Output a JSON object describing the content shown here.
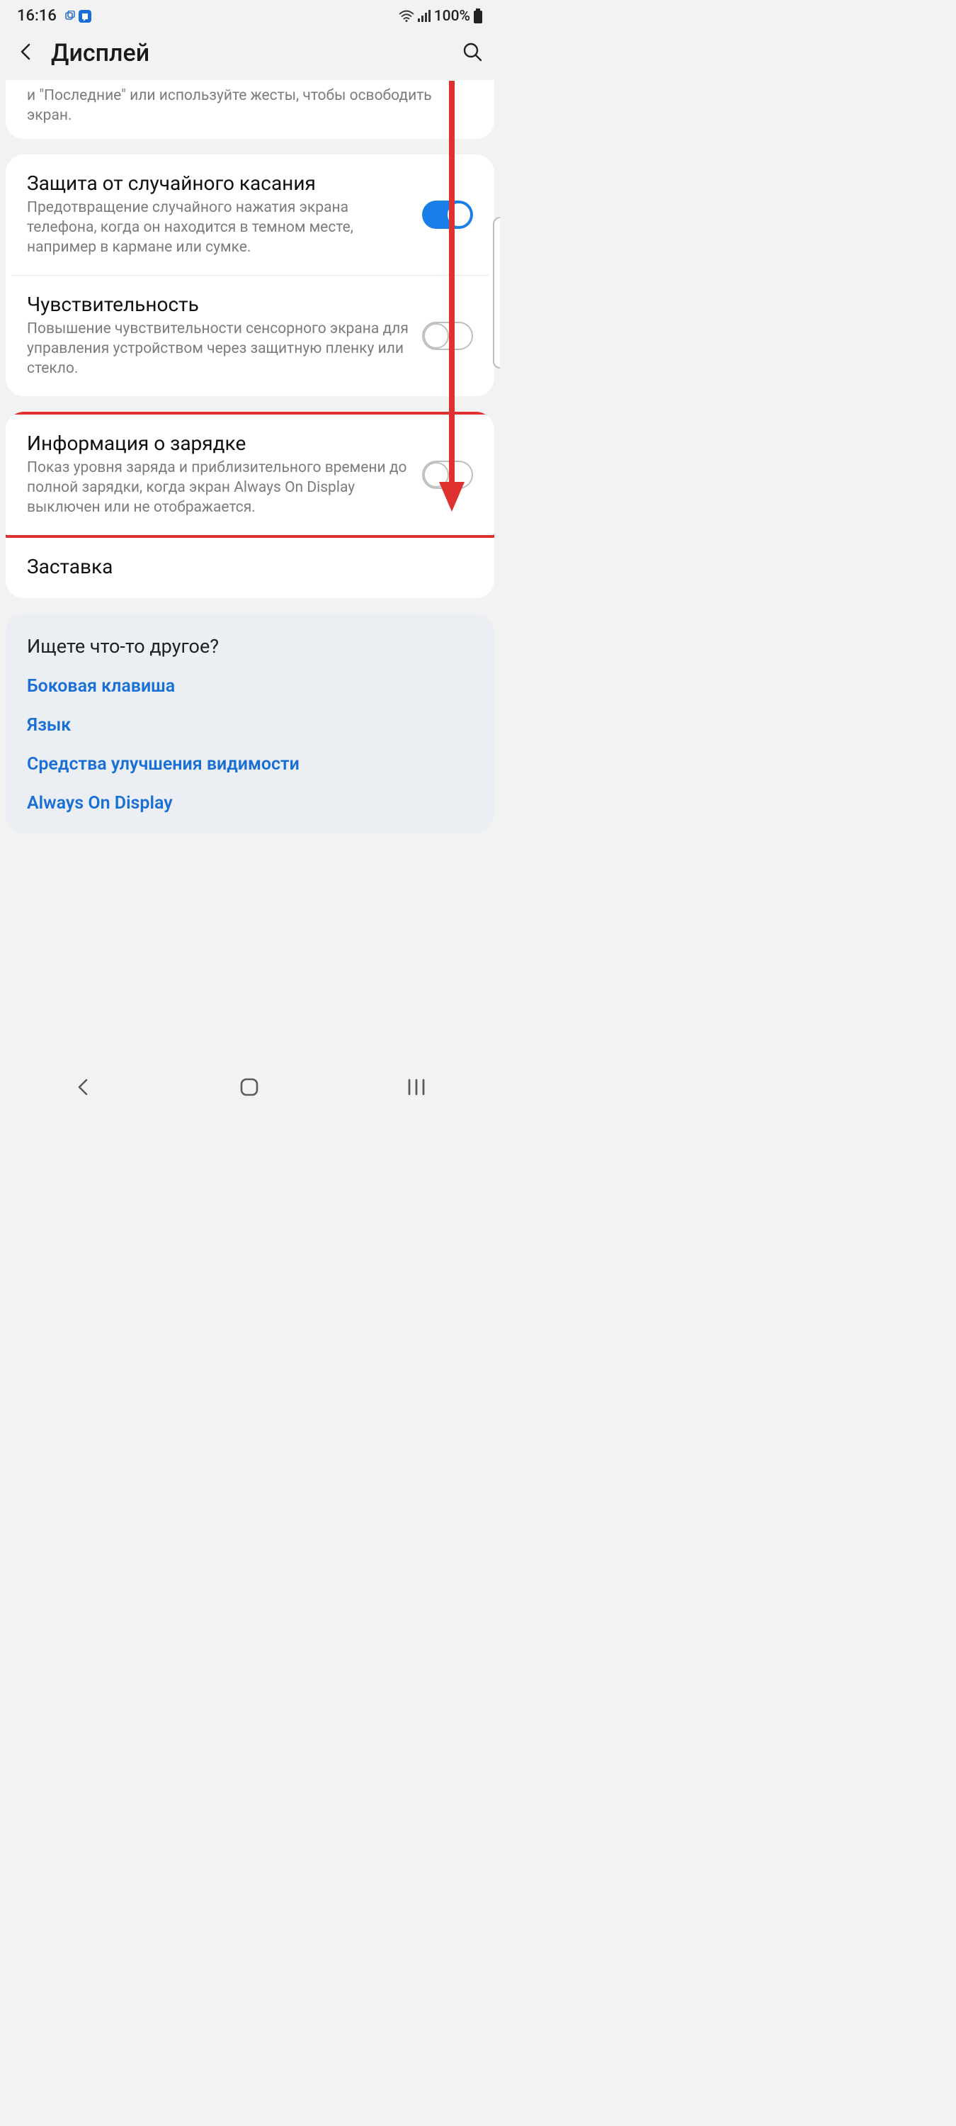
{
  "status": {
    "time": "16:16",
    "battery_text": "100%"
  },
  "header": {
    "title": "Дисплей"
  },
  "partial_row": {
    "sub": "и \"Последние\" или используйте жесты, чтобы освободить экран."
  },
  "rows": {
    "touch_protect": {
      "title": "Защита от случайного касания",
      "sub": "Предотвращение случайного нажатия экрана телефона, когда он находится в темном месте, например в кармане или сумке.",
      "on": true
    },
    "sensitivity": {
      "title": "Чувствительность",
      "sub": "Повышение чувствительности сенсорного экрана для управления устройством через защитную пленку или стекло.",
      "on": false
    },
    "charging_info": {
      "title": "Информация о зарядке",
      "sub": "Показ уровня заряда и приблизительного времени до полной зарядки, когда экран Always On Display выключен или не отображается.",
      "on": false
    },
    "screensaver": {
      "title": "Заставка"
    }
  },
  "other": {
    "heading": "Ищете что-то другое?",
    "links": [
      "Боковая клавиша",
      "Язык",
      "Средства улучшения видимости",
      "Always On Display"
    ]
  }
}
